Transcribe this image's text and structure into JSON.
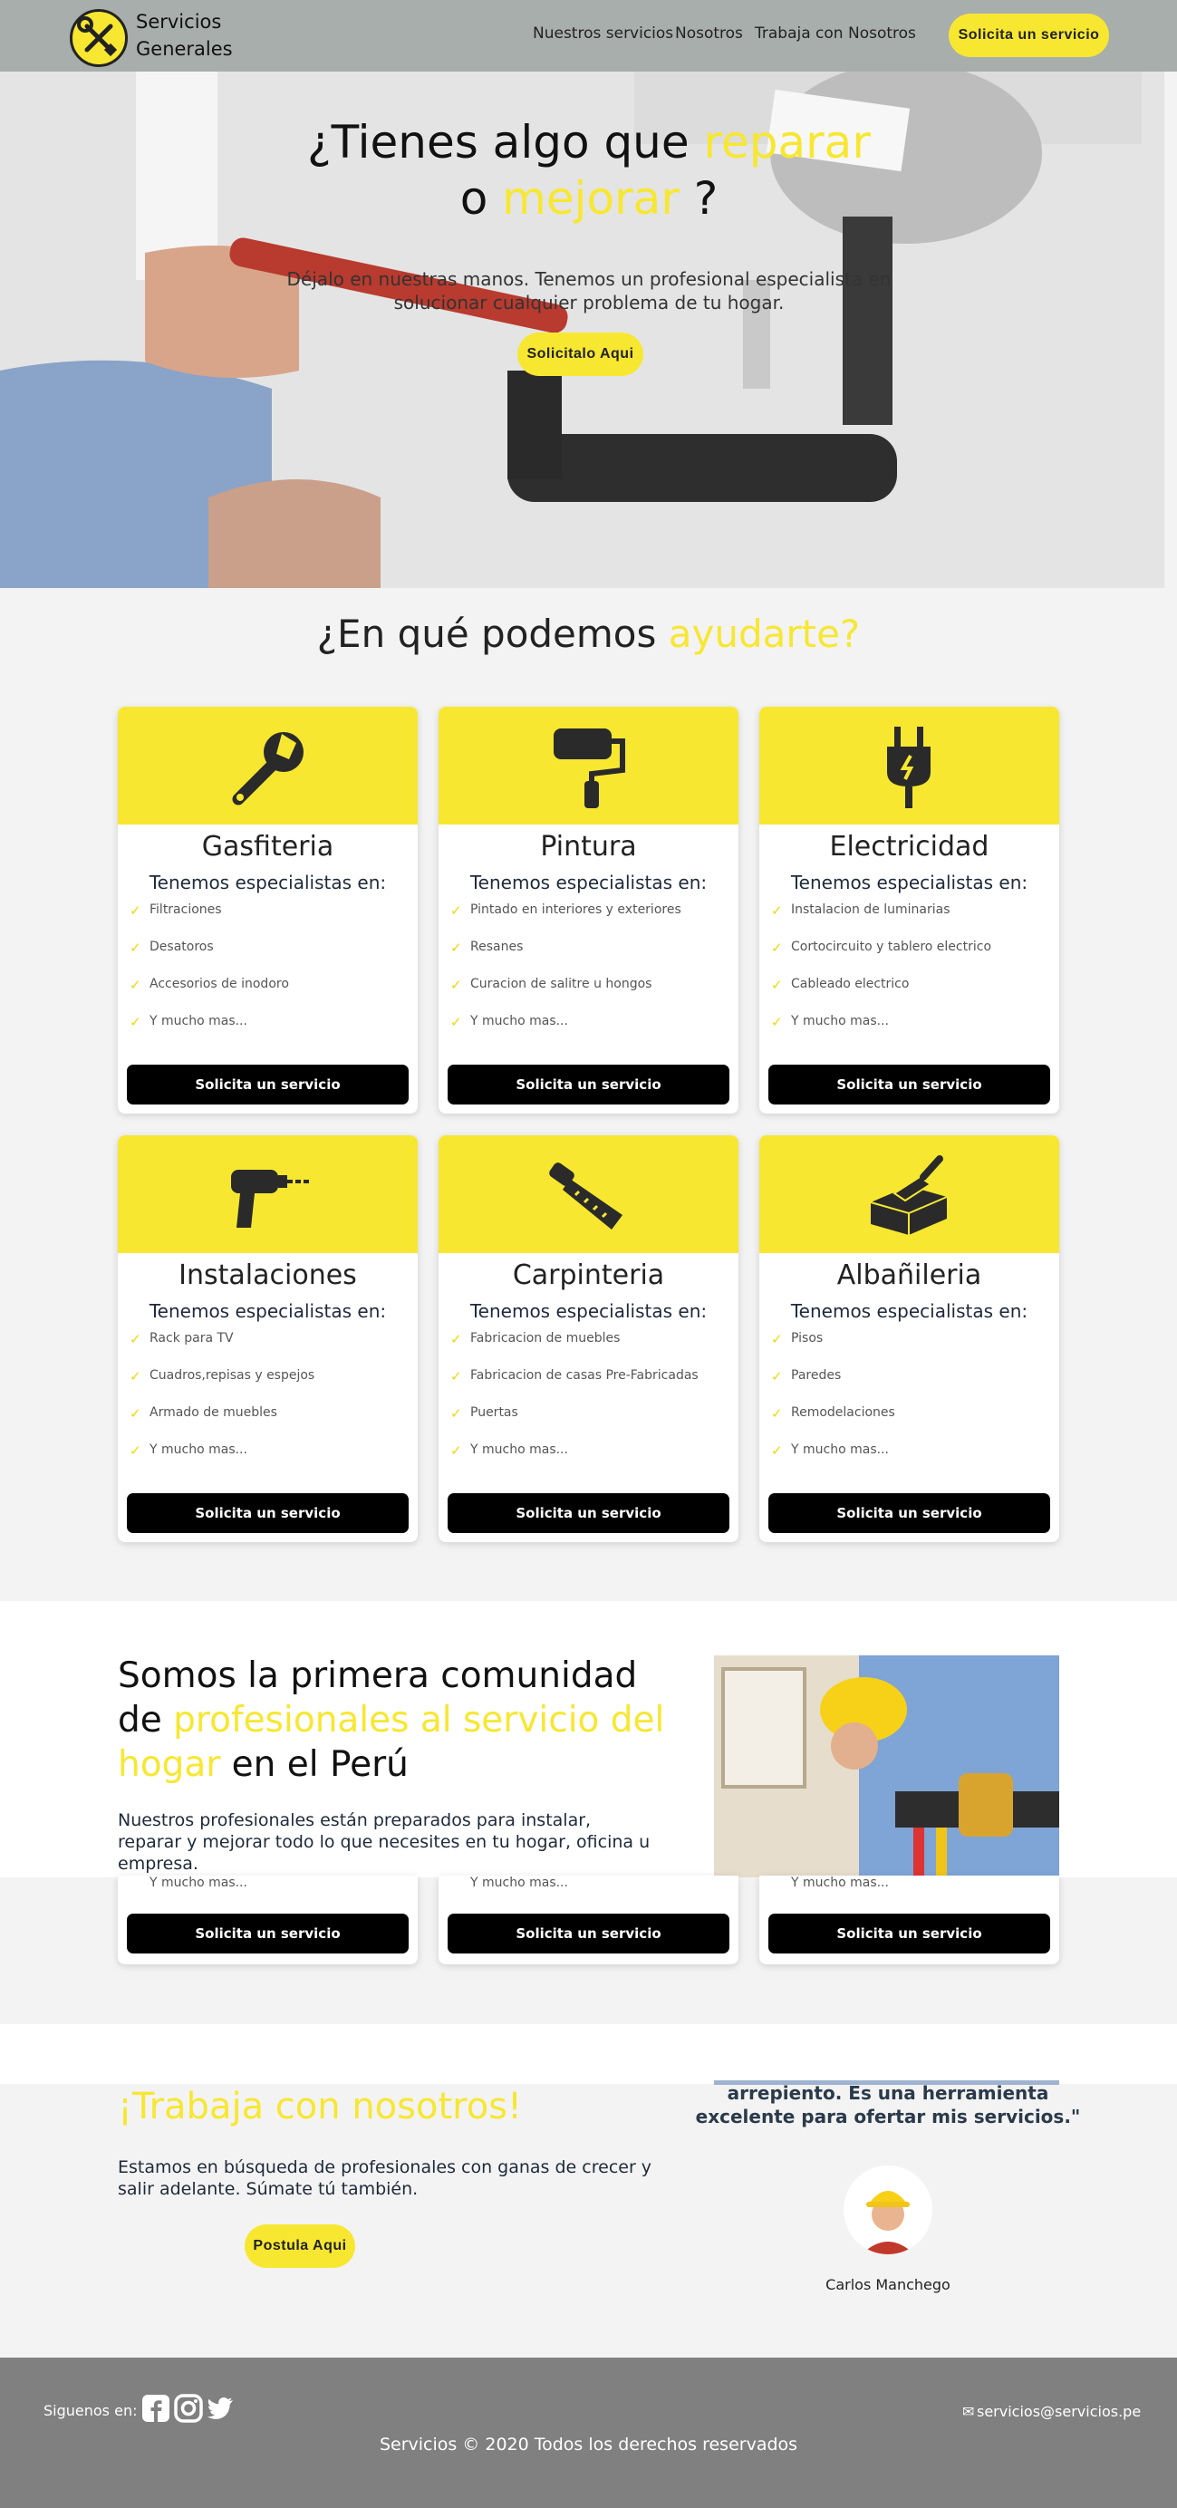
{
  "header": {
    "brand_line1": "Servicios",
    "brand_line2": "Generales",
    "nav": [
      "Nuestros servicios",
      "Nosotros",
      "Trabaja con Nosotros"
    ],
    "cta": "Solicita un servicio",
    "logo_icon": "tools-icon"
  },
  "hero": {
    "title_part1": "¿Tienes algo que ",
    "title_highlight1": "reparar",
    "title_part2": "o ",
    "title_highlight2": "mejorar",
    "title_part3": " ?",
    "subtitle": "Déjalo en nuestras manos. Tenemos un profesional especialista en solucionar cualquier problema de tu hogar.",
    "button": "Solicitalo Aqui"
  },
  "services": {
    "title_part1": "¿En qué podemos ",
    "title_highlight": "ayudarte?",
    "cards": [
      {
        "title": "Gasfiteria",
        "subtitle": "Tenemos especialistas en:",
        "icon": "wrench-icon",
        "items": [
          "Filtraciones",
          "Desatoros",
          "Accesorios de inodoro",
          "Y mucho mas..."
        ],
        "button": "Solicita un servicio"
      },
      {
        "title": "Pintura",
        "subtitle": "Tenemos especialistas en:",
        "icon": "paint-roller-icon",
        "items": [
          "Pintado en interiores y exteriores",
          "Resanes",
          "Curacion de salitre u hongos",
          "Y mucho mas..."
        ],
        "button": "Solicita un servicio"
      },
      {
        "title": "Electricidad",
        "subtitle": "Tenemos especialistas en:",
        "icon": "plug-icon",
        "items": [
          "Instalacion de luminarias",
          "Cortocircuito y tablero electrico",
          "Cableado electrico",
          "Y mucho mas..."
        ],
        "button": "Solicita un servicio"
      },
      {
        "title": "Instalaciones",
        "subtitle": "Tenemos especialistas en:",
        "icon": "drill-icon",
        "items": [
          "Rack para TV",
          "Cuadros,repisas y espejos",
          "Armado de muebles",
          "Y mucho mas..."
        ],
        "button": "Solicita un servicio"
      },
      {
        "title": "Carpinteria",
        "subtitle": "Tenemos especialistas en:",
        "icon": "saw-icon",
        "items": [
          "Fabricacion de muebles",
          "Fabricacion de casas Pre-Fabricadas",
          "Puertas",
          "Y mucho mas..."
        ],
        "button": "Solicita un servicio"
      },
      {
        "title": "Albañileria",
        "subtitle": "Tenemos especialistas en:",
        "icon": "brick-trowel-icon",
        "items": [
          "Pisos",
          "Paredes",
          "Remodelaciones",
          "Y mucho mas..."
        ],
        "button": "Solicita un servicio"
      }
    ]
  },
  "community": {
    "title_part1": "Somos la primera comunidad de ",
    "title_highlight": "profesionales al servicio del hogar",
    "title_part2": " en el Perú",
    "text": "Nuestros profesionales están preparados para instalar, reparar y mejorar todo lo que necesites en tu hogar, oficina u empresa."
  },
  "partial_row": {
    "item": "Y mucho mas...",
    "button": "Solicita un servicio"
  },
  "work": {
    "title": "¡Trabaja con nosotros!",
    "text": "Estamos en búsqueda de profesionales con ganas de crecer y salir adelante. Súmate tú también.",
    "button": "Postula Aqui",
    "quote": "arrepiento. Es una herramienta excelente para ofertar mis servicios.\"",
    "author": "Carlos Manchego"
  },
  "footer": {
    "follow": "Siguenos en:",
    "social": [
      "facebook-icon",
      "instagram-icon",
      "twitter-icon"
    ],
    "email": "servicios@servicios.pe",
    "copyright": "Servicios © 2020 Todos los derechos reservados"
  },
  "colors": {
    "accent": "#f7e731",
    "header_bg": "#a8aeab",
    "footer_bg": "#808080",
    "button_dark": "#000000"
  }
}
